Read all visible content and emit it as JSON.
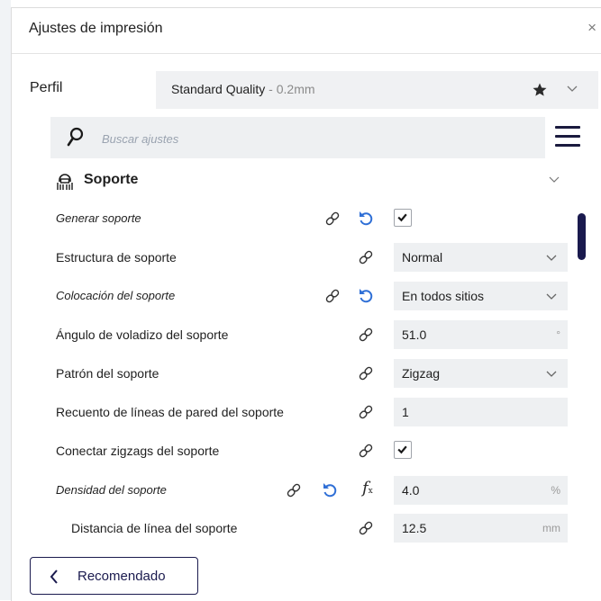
{
  "window": {
    "title": "Ajustes de impresión",
    "close_label": "×"
  },
  "profile": {
    "label": "Perfil",
    "name": "Standard Quality",
    "detail": " - 0.2mm"
  },
  "search": {
    "placeholder": "Buscar ajustes"
  },
  "section": {
    "title": "Soporte"
  },
  "settings": [
    {
      "label": "Generar soporte",
      "type": "checkbox",
      "checked": true,
      "italic": true,
      "linked": true,
      "resettable": true
    },
    {
      "label": "Estructura de soporte",
      "type": "select",
      "value": "Normal",
      "italic": false,
      "linked": true,
      "resettable": false
    },
    {
      "label": "Colocación del soporte",
      "type": "select",
      "value": "En todos sitios",
      "italic": true,
      "linked": true,
      "resettable": true
    },
    {
      "label": "Ángulo de voladizo del soporte",
      "type": "number",
      "value": "51.0",
      "unit": "°",
      "italic": false,
      "linked": true,
      "resettable": false
    },
    {
      "label": "Patrón del soporte",
      "type": "select",
      "value": "Zigzag",
      "italic": false,
      "linked": true,
      "resettable": false
    },
    {
      "label": "Recuento de líneas de pared del soporte",
      "type": "number",
      "value": "1",
      "unit": "",
      "italic": false,
      "linked": true,
      "resettable": false
    },
    {
      "label": "Conectar zigzags del soporte",
      "type": "checkbox",
      "checked": true,
      "italic": false,
      "linked": true,
      "resettable": false
    },
    {
      "label": "Densidad del soporte",
      "type": "number",
      "value": "4.0",
      "unit": "%",
      "italic": true,
      "linked": true,
      "resettable": true,
      "formula": true,
      "formula_symbol": "f",
      "formula_subscript": "x"
    },
    {
      "label": "Distancia de línea del soporte",
      "type": "number",
      "value": "12.5",
      "unit": "mm",
      "italic": false,
      "linked": true,
      "resettable": false,
      "indented": true
    }
  ],
  "footer": {
    "recommended_label": "Recomendado"
  },
  "colors": {
    "accent": "#1a1a4e",
    "reset_blue": "#2f6fd6",
    "field_bg": "#eef0f2"
  },
  "icons": [
    "close-icon",
    "star-icon",
    "chevron-down-icon",
    "search-icon",
    "menu-icon",
    "support-icon",
    "link-icon",
    "reset-icon",
    "formula-icon",
    "checkmark-icon",
    "chevron-left-icon"
  ]
}
